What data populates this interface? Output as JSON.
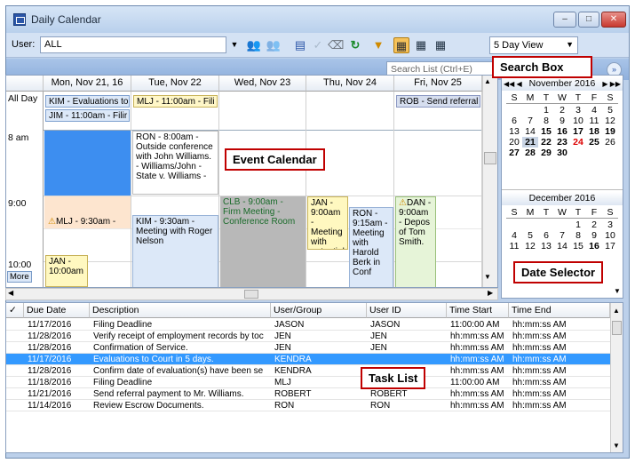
{
  "window": {
    "title": "Daily Calendar",
    "min": "–",
    "max": "□",
    "close": "✕"
  },
  "toolbar": {
    "user_label": "User:",
    "user_value": "ALL",
    "view_value": "5 Day View"
  },
  "search": {
    "placeholder": "Search List (Ctrl+E)"
  },
  "callouts": {
    "search": "Search Box",
    "calendar": "Event Calendar",
    "dates": "Date Selector",
    "tasks": "Task List"
  },
  "calendar": {
    "all_day": "All Day",
    "days": [
      "Mon, Nov 21, 16",
      "Tue, Nov 22",
      "Wed, Nov 23",
      "Thu, Nov 24",
      "Fri, Nov 25"
    ],
    "times": [
      "8 am",
      "9:00",
      "10:00"
    ],
    "more": "More",
    "events": {
      "kim_allday": "KIM - Evaluations to",
      "mlj_allday": "MLJ - 11:00am - Fili",
      "rob_allday": "ROB - Send referral",
      "jim_allday": "JIM - 11:00am - Filir",
      "ron_8": "RON - 8:00am - Outside conference with John Williams. - Williams/John - State v. Williams -",
      "mlj_930": "MLJ - 9:30am -",
      "kim_930": "KIM - 9:30am - Meeting with Roger Nelson",
      "clb_9": "CLB - 9:00am - Firm Meeting - Conference Room",
      "jan_9": "JAN - 9:00am - Meeting with potential",
      "ron_915": "RON - 9:15am - Meeting with Harold Berk in Conf",
      "dan_9": "DAN - 9:00am - Depos of Tom Smith.",
      "jan_10": "JAN - 10:00am"
    }
  },
  "dateselector": {
    "months": [
      {
        "title": "November 2016",
        "nav_prev": "◀◀ ◀",
        "nav_next": "▶ ▶▶",
        "weekdays": [
          "S",
          "M",
          "T",
          "W",
          "T",
          "F",
          "S"
        ],
        "cells": [
          "",
          "",
          "1",
          "2",
          "3",
          "4",
          "5",
          "6",
          "7",
          "8",
          "9",
          "10",
          "11",
          "12",
          "13",
          "14",
          "15",
          "16",
          "17",
          "18",
          "19",
          "20",
          "21",
          "22",
          "23",
          "24",
          "25",
          "26",
          "27",
          "28",
          "29",
          "30",
          "",
          "",
          ""
        ]
      },
      {
        "title": "December 2016",
        "weekdays": [
          "S",
          "M",
          "T",
          "W",
          "T",
          "F",
          "S"
        ],
        "cells": [
          "",
          "",
          "",
          "",
          "1",
          "2",
          "3",
          "4",
          "5",
          "6",
          "7",
          "8",
          "9",
          "10",
          "11",
          "12",
          "13",
          "14",
          "15",
          "16",
          "17"
        ]
      }
    ]
  },
  "tasks": {
    "headers": [
      "✓",
      "Due Date",
      "Description",
      "User/Group",
      "User ID",
      "Time Start",
      "Time End"
    ],
    "rows": [
      [
        "11/17/2016",
        "Filing Deadline",
        "JASON",
        "JASON",
        "11:00:00 AM",
        "hh:mm:ss AM"
      ],
      [
        "11/28/2016",
        "Verify receipt of employment records by toc",
        "JEN",
        "JEN",
        "hh:mm:ss AM",
        "hh:mm:ss AM"
      ],
      [
        "11/28/2016",
        "Confirmation of Service.",
        "JEN",
        "JEN",
        "hh:mm:ss AM",
        "hh:mm:ss AM"
      ],
      [
        "11/17/2016",
        "Evaluations to Court in 5 days.",
        "KENDRA",
        "",
        "hh:mm:ss AM",
        "hh:mm:ss AM"
      ],
      [
        "11/28/2016",
        "Confirm date of evaluation(s) have been se",
        "KENDRA",
        "",
        "hh:mm:ss AM",
        "hh:mm:ss AM"
      ],
      [
        "11/18/2016",
        "Filing Deadline",
        "MLJ",
        "MLJ",
        "11:00:00 AM",
        "hh:mm:ss AM"
      ],
      [
        "11/21/2016",
        "Send referral payment to Mr. Williams.",
        "ROBERT",
        "ROBERT",
        "hh:mm:ss AM",
        "hh:mm:ss AM"
      ],
      [
        "11/14/2016",
        "Review Escrow Documents.",
        "RON",
        "RON",
        "hh:mm:ss AM",
        "hh:mm:ss AM"
      ]
    ]
  }
}
